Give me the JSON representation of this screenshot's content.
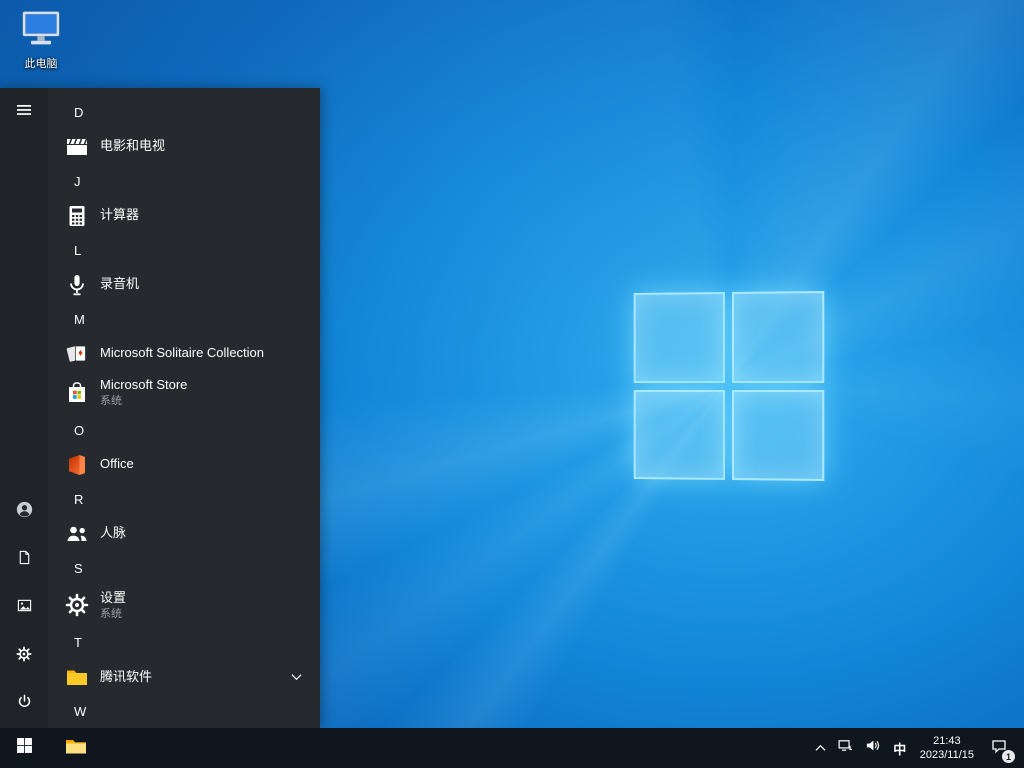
{
  "desktop": {
    "icons": [
      {
        "label": "此电脑"
      }
    ]
  },
  "start_menu": {
    "sections": [
      {
        "letter": "D",
        "apps": [
          {
            "label": "电影和电视"
          }
        ]
      },
      {
        "letter": "J",
        "apps": [
          {
            "label": "计算器"
          }
        ]
      },
      {
        "letter": "L",
        "apps": [
          {
            "label": "录音机"
          }
        ]
      },
      {
        "letter": "M",
        "apps": [
          {
            "label": "Microsoft Solitaire Collection"
          },
          {
            "label": "Microsoft Store",
            "sublabel": "系统"
          }
        ]
      },
      {
        "letter": "O",
        "apps": [
          {
            "label": "Office"
          }
        ]
      },
      {
        "letter": "R",
        "apps": [
          {
            "label": "人脉"
          }
        ]
      },
      {
        "letter": "S",
        "apps": [
          {
            "label": "设置",
            "sublabel": "系统"
          }
        ]
      },
      {
        "letter": "T",
        "apps": [
          {
            "label": "腾讯软件",
            "expandable": true
          }
        ]
      },
      {
        "letter": "W",
        "apps": []
      }
    ]
  },
  "taskbar": {
    "ime": "中",
    "clock": {
      "time": "21:43",
      "date": "2023/11/15"
    },
    "badge": "1"
  },
  "icons": {
    "rail": [
      "hamburger-icon",
      "account-icon",
      "documents-icon",
      "pictures-icon",
      "settings-gear-icon",
      "power-icon"
    ],
    "tray": [
      "chevron-up-icon",
      "network-icon",
      "volume-icon",
      "action-center-icon"
    ],
    "apps": [
      "movies-tv-icon",
      "calculator-icon",
      "voice-recorder-icon",
      "solitaire-icon",
      "store-icon",
      "office-icon",
      "people-icon",
      "folder-icon"
    ]
  },
  "colors": {
    "wallpaper_blue": "#1286d8",
    "logo_cyan": "#aeeaff",
    "menu_bg": "#26292e",
    "taskbar_bg": "#10161d",
    "folder_yellow": "#ffca28"
  }
}
